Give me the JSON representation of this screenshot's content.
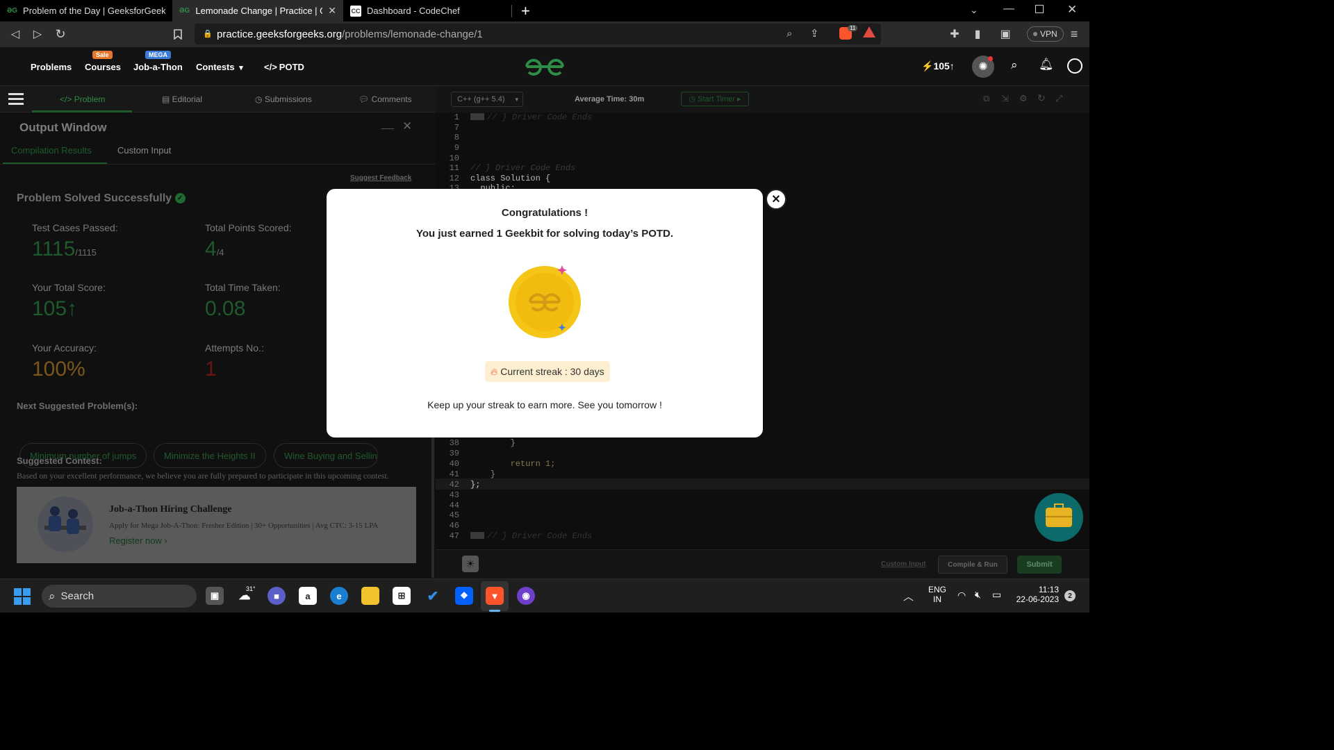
{
  "browser": {
    "tabs": [
      {
        "title": "Problem of the Day | GeeksforGeeks | ...",
        "favicon": "gfg-icon",
        "active": false
      },
      {
        "title": "Lemonade Change | Practice | Gee...",
        "favicon": "gfg-icon",
        "active": true
      },
      {
        "title": "Dashboard - CodeChef",
        "favicon": "codechef-icon",
        "active": false
      }
    ],
    "new_tab": "+",
    "url_host": "practice.geeksforgeeks.org",
    "url_path": "/problems/lemonade-change/1",
    "vpn_label": "VPN",
    "shield_count": "11"
  },
  "gfg_header": {
    "nav": {
      "problems": "Problems",
      "courses": "Courses",
      "courses_badge": "Sale",
      "jobathon": "Job-a-Thon",
      "jobathon_badge": "MEGA",
      "contests": "Contests",
      "potd": "POTD"
    },
    "streak_count": "105"
  },
  "problem_tabs": {
    "problem": "Problem",
    "editorial": "Editorial",
    "submissions": "Submissions",
    "comments": "Comments"
  },
  "output_window": {
    "title": "Output Window",
    "tab_compile": "Compilation Results",
    "tab_custom": "Custom Input",
    "suggest_feedback": "Suggest Feedback",
    "solved_title": "Problem Solved Successfully",
    "test_cases_label": "Test Cases Passed:",
    "test_cases_value": "1115",
    "test_cases_total": "/1115",
    "points_label": "Total Points Scored:",
    "points_value": "4",
    "points_total": "/4",
    "score_label": "Your Total Score:",
    "score_value": "105",
    "time_label": "Total Time Taken:",
    "time_value": "0.08",
    "accuracy_label": "Your Accuracy:",
    "accuracy_value": "100%",
    "attempts_label": "Attempts No.:",
    "attempts_value": "1",
    "next_label": "Next Suggested Problem(s):",
    "next_problems": [
      "Minimum number of jumps",
      "Minimize the Heights II",
      "Wine Buying and Selling"
    ],
    "contest_label": "Suggested Contest:",
    "contest_desc": "Based on your excellent performance, we believe you are fully prepared to participate in this upcoming contest.",
    "contest_title": "Job-a-Thon Hiring Challenge",
    "contest_sub": "Apply for Mega Job-A-Thon: Fresher Edition | 30+ Opportunities | Avg CTC: 3-15 LPA",
    "contest_link": "Register now ›"
  },
  "editor": {
    "language": "C++ (g++ 5.4)",
    "avg_time": "Average Time: 30m",
    "start_timer": "Start Timer",
    "lines": [
      {
        "n": "1",
        "code": "// } Driver Code Ends",
        "folded": true
      },
      {
        "n": "7",
        "code": ""
      },
      {
        "n": "8",
        "code": ""
      },
      {
        "n": "9",
        "code": ""
      },
      {
        "n": "10",
        "code": ""
      },
      {
        "n": "11",
        "code": "// } Driver Code Ends"
      },
      {
        "n": "12",
        "code": "class Solution {"
      },
      {
        "n": "13",
        "code": "  public:"
      }
    ],
    "lines_bottom": [
      {
        "n": "38",
        "code": "        }"
      },
      {
        "n": "39",
        "code": ""
      },
      {
        "n": "40",
        "code": "        return 1;"
      },
      {
        "n": "41",
        "code": "    }"
      },
      {
        "n": "42",
        "code": "};"
      },
      {
        "n": "43",
        "code": ""
      },
      {
        "n": "44",
        "code": ""
      },
      {
        "n": "45",
        "code": ""
      },
      {
        "n": "46",
        "code": ""
      },
      {
        "n": "47",
        "code": "// } Driver Code Ends",
        "folded": true
      }
    ],
    "custom_input": "Custom Input",
    "compile_run": "Compile & Run",
    "submit": "Submit"
  },
  "modal": {
    "title": "Congratulations !",
    "subtitle": "You just earned 1 Geekbit for solving today’s POTD.",
    "streak": "Current streak : 30 days",
    "footer": "Keep up your streak to earn more. See you tomorrow !"
  },
  "taskbar": {
    "search": "Search",
    "weather": "31°",
    "lang_top": "ENG",
    "lang_bottom": "IN",
    "time": "11:13",
    "date": "22-06-2023",
    "notif": "2"
  },
  "colors": {
    "gfg_green": "#2f8d46",
    "coin_yellow": "#f5c518",
    "accuracy_orange": "#b07a1e",
    "attempts_red": "#8b1d1d"
  }
}
